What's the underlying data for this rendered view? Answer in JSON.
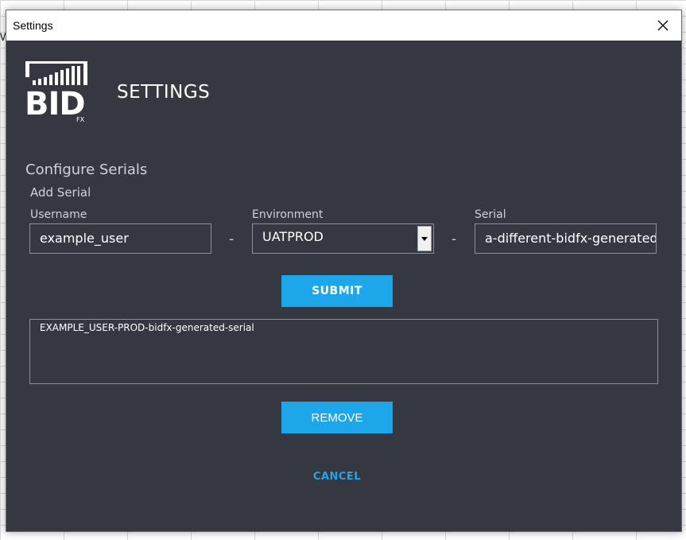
{
  "window": {
    "title": "Settings"
  },
  "header": {
    "logo_text": "BID",
    "logo_subtext": "FX",
    "title": "SETTINGS"
  },
  "configure": {
    "section_title": "Configure Serials",
    "add_title": "Add Serial",
    "username": {
      "label": "Username",
      "value": "example_user"
    },
    "environment": {
      "label": "Environment",
      "value": "UATPROD"
    },
    "serial": {
      "label": "Serial",
      "value": "a-different-bidfx-generated-serial"
    },
    "separator": "-",
    "submit_label": "SUBMIT"
  },
  "serials_list": {
    "items": [
      "EXAMPLE_USER-PROD-bidfx-generated-serial"
    ]
  },
  "actions": {
    "remove_label": "REMOVE",
    "cancel_label": "CANCEL"
  },
  "colors": {
    "window_bg": "#353840",
    "accent": "#1ea6ea",
    "text": "#ffffff",
    "muted_text": "#cfd2d8"
  },
  "icons": {
    "close": "close-icon",
    "dropdown": "chevron-down-icon",
    "logo": "bidfx-logo"
  }
}
